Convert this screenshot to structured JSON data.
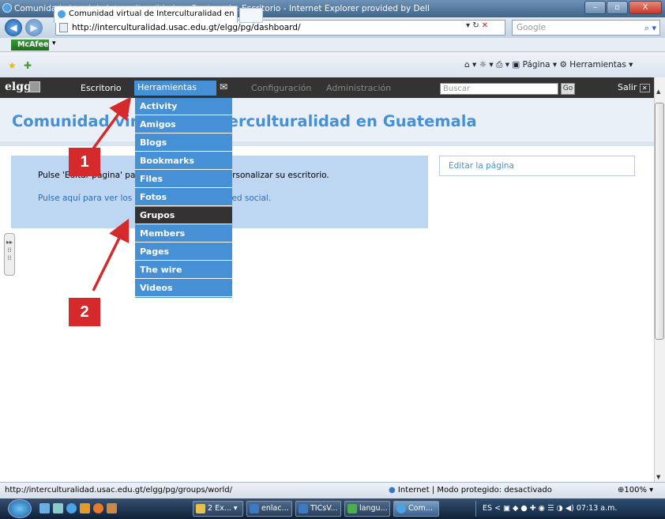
{
  "window": {
    "title": "Comunidad virtual de Interculturalidad en Guatemala: Escritorio - Internet Explorer provided by Dell",
    "min": "–",
    "max": "▫",
    "close": "X"
  },
  "browser": {
    "url": "http://interculturalidad.usac.edu.gt/elgg/pg/dashboard/",
    "search_placeholder": "Google",
    "mcafee": "McAfee",
    "tab_title": "Comunidad virtual de Interculturalidad en Guate...",
    "cmd_pagina": "Página",
    "cmd_herramientas": "Herramientas"
  },
  "elgg_toolbar": {
    "logo": "elgg",
    "escritorio": "Escritorio",
    "herramientas": "Herramientas",
    "configuracion": "Configuración",
    "administracion": "Administración",
    "search_placeholder": "Buscar",
    "go": "Go",
    "salir": "Salir"
  },
  "page": {
    "title": "Comunidad virtual de Interculturalidad en Guatemala",
    "message1": "Pulse 'Editar página' para editar la página y personalizar su escritorio.",
    "message2": "Pulse aquí para ver los últimos ingresos en la red social.",
    "edit_page": "Editar la página"
  },
  "menu": {
    "items": [
      "Activity",
      "Amigos",
      "Blogs",
      "Bookmarks",
      "Files",
      "Fotos",
      "Grupos",
      "Members",
      "Pages",
      "The wire",
      "Videos"
    ],
    "active": "Grupos"
  },
  "annotations": {
    "badge1": "1",
    "badge2": "2",
    "arrow_color": "#d6292b"
  },
  "status": {
    "url": "http://interculturalidad.usac.edu.gt/elgg/pg/groups/world/",
    "zone": "Internet | Modo protegido: desactivado",
    "zoom": "100%"
  },
  "taskbar": {
    "items": [
      "2 Ex...",
      "enlac...",
      "TICsV...",
      "langu...",
      "Com..."
    ],
    "lang": "ES",
    "time": "07:13 a.m."
  },
  "colors": {
    "elgg_blue": "#4690d6",
    "toolbar": "#333333",
    "box": "#bdd6f1"
  }
}
